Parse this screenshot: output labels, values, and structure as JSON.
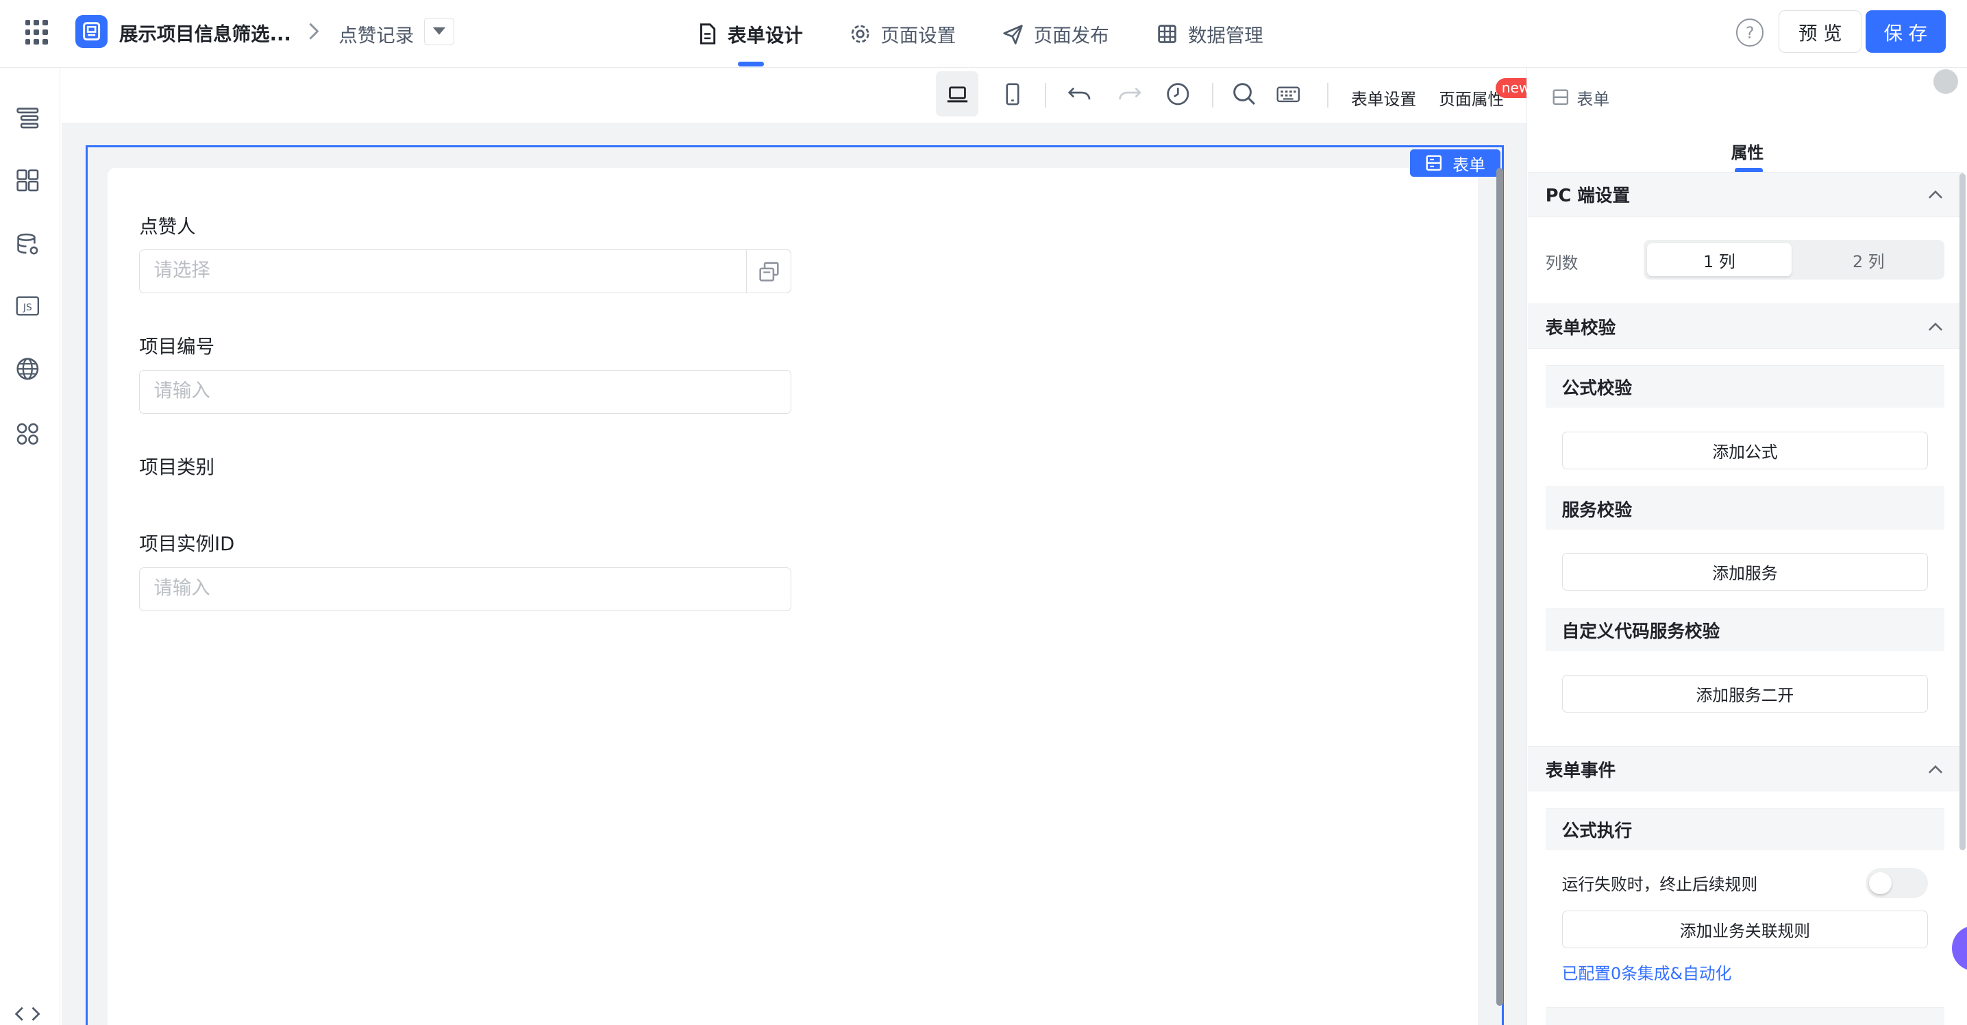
{
  "header": {
    "app_title": "展示项目信息筛选...",
    "breadcrumb_page": "点赞记录",
    "tabs": [
      {
        "label": "表单设计",
        "icon": "document-icon"
      },
      {
        "label": "页面设置",
        "icon": "gear-icon"
      },
      {
        "label": "页面发布",
        "icon": "send-icon"
      },
      {
        "label": "数据管理",
        "icon": "table-icon"
      }
    ],
    "help": "?",
    "preview_label": "预 览",
    "save_label": "保 存"
  },
  "toolbar": {
    "form_settings": "表单设置",
    "page_props": "页面属性",
    "new_badge": "new"
  },
  "canvas": {
    "form_tag": "表单",
    "fields": [
      {
        "label": "点赞人",
        "placeholder": "请选择"
      },
      {
        "label": "项目编号",
        "placeholder": "请输入"
      },
      {
        "label": "项目类别",
        "placeholder": ""
      },
      {
        "label": "项目实例ID",
        "placeholder": "请输入"
      }
    ]
  },
  "right_panel": {
    "title": "表单",
    "tab": "属性",
    "pc_settings": {
      "title": "PC 端设置",
      "columns_label": "列数",
      "options": [
        "1 列",
        "2 列"
      ],
      "selected": "1 列"
    },
    "validation": {
      "title": "表单校验",
      "formula_title": "公式校验",
      "formula_btn": "添加公式",
      "service_title": "服务校验",
      "service_btn": "添加服务",
      "custom_title": "自定义代码服务校验",
      "custom_btn": "添加服务二开"
    },
    "events": {
      "title": "表单事件",
      "formula_exec_title": "公式执行",
      "stop_on_fail": "运行失败时，终止后续规则",
      "add_rule_btn": "添加业务关联规则",
      "configured_link": "已配置0条集成&自动化"
    }
  }
}
